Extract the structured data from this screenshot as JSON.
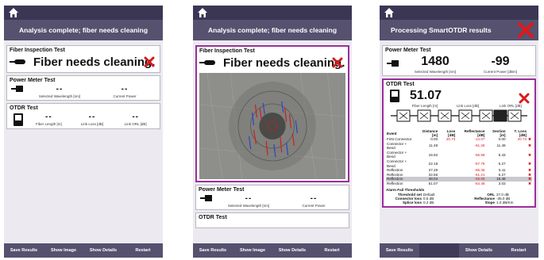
{
  "screens": [
    {
      "banner": "Analysis complete; fiber needs cleaning",
      "fiber_inspection": {
        "title": "Fiber Inspection Test",
        "message": "Fiber needs cleaning."
      },
      "power_meter": {
        "title": "Power Meter Test",
        "values": [
          "--",
          "--"
        ],
        "labels": [
          "Selected Wavelength [nm]",
          "Current Power"
        ]
      },
      "otdr": {
        "title": "OTDR Test",
        "values": [
          "--",
          "--",
          "--"
        ],
        "labels": [
          "Fiber Length [m]",
          "Link Loss [dB]",
          "Link ORL [dB]"
        ]
      },
      "footer": [
        "Save Results",
        "Show Image",
        "Show Details",
        "Restart"
      ]
    },
    {
      "banner": "Analysis complete; fiber needs cleaning",
      "fiber_inspection": {
        "title": "Fiber Inspection Test",
        "message": "Fiber needs cleaning."
      },
      "power_meter": {
        "title": "Power Meter Test",
        "values": [
          "--",
          "--"
        ],
        "labels": [
          "Selected Wavelength [nm]",
          "Current Power"
        ]
      },
      "otdr": {
        "title": "OTDR Test"
      },
      "footer": [
        "Save Results",
        "Show Image",
        "Show Details",
        "Restart"
      ]
    },
    {
      "banner": "Processing SmartOTDR results",
      "power_meter": {
        "title": "Power Meter Test",
        "values": [
          "1480",
          "-99"
        ],
        "labels": [
          "Selected Wavelength [nm]",
          "Current Power [dBm]"
        ]
      },
      "otdr": {
        "title": "OTDR Test",
        "length": "51.07",
        "labels": [
          "Fiber Length [m]",
          "Link Loss [dB]",
          "Link ORL [dB]"
        ],
        "headers": [
          "Event",
          "Distance [m]",
          "Loss [dB]",
          "Reflectance [dB]",
          "Section [m]",
          "T. Loss [dB]"
        ],
        "rows": [
          [
            "First Connector",
            "0.00",
            "20.73",
            "-14.07",
            "0.00",
            "20.73"
          ],
          [
            "Connector + Bend",
            "11.49",
            "",
            "-61.26",
            "11.49",
            ""
          ],
          [
            "Connector + Bend",
            "16.92",
            "",
            "-56.58",
            "5.43",
            ""
          ],
          [
            "Connector + Bend",
            "22.18",
            "",
            "-57.75",
            "5.27",
            ""
          ],
          [
            "Reflection",
            "27.29",
            "",
            "-65.45",
            "5.11",
            ""
          ],
          [
            "Reflection",
            "32.56",
            "",
            "-61.21",
            "5.27",
            ""
          ],
          [
            "Reflection",
            "48.04",
            "",
            "-58.88",
            "15.48",
            ""
          ],
          [
            "Reflection",
            "51.07",
            "",
            "-54.48",
            "3.03",
            ""
          ]
        ],
        "thresholds": {
          "title": "Alarm Fail Thresholds",
          "threshold_set_label": "Threshold set",
          "threshold_set": "Default",
          "connector_loss_label": "Connector loss",
          "connector_loss": "0.5 dB",
          "splice_loss_label": "Splice loss",
          "splice_loss": "0.2 dB",
          "orl_label": "ORL",
          "orl": "27.0 dB",
          "reflectance_label": "Reflectance",
          "reflectance": "-35.0 dB",
          "slope_label": "Slope",
          "slope": "1.0 dB/Km"
        }
      },
      "footer": [
        "Save Results",
        "",
        "Show Details",
        "Restart"
      ]
    }
  ],
  "colors": {
    "topbar": "#3a3654",
    "banner": "#55516f",
    "fail": "#d41c1c",
    "highlight": "#9b2f9b"
  }
}
